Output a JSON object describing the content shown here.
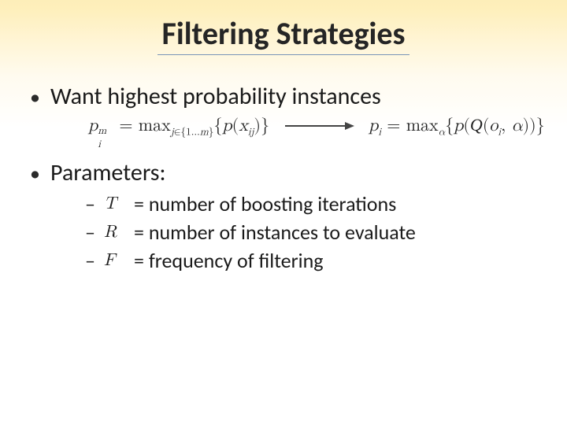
{
  "title": "Filtering Strategies",
  "bullet1": "Want highest probability instances",
  "formula_left_html": "<i>p</i><span class='ss'><span class='sup'><i>m</i></span><span class='sub'><i>i</i></span></span>&nbsp;=&nbsp;max<sub><i>j</i>∈{1…<i>m</i>}</sub>{<i>p</i>(<i>x</i><sub><i>ij</i></sub>)}",
  "formula_right_html": "<i>p</i><sub><i>i</i></sub>&nbsp;=&nbsp;max<sub><i>α</i></sub>{<i>p</i>(<span class='cal'>Q</span>(<i>o</i><sub><i>i</i></sub>,&nbsp;<i>α</i>))}",
  "bullet2": "Parameters:",
  "params": [
    {
      "symbol": "T",
      "desc": "= number of boosting iterations"
    },
    {
      "symbol": "R",
      "desc": "= number of instances to evaluate"
    },
    {
      "symbol": "F",
      "desc": "= frequency of filtering"
    }
  ]
}
